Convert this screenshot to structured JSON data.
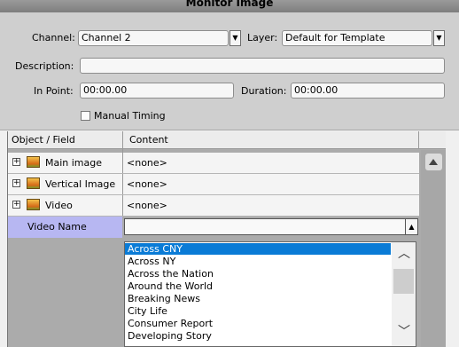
{
  "window": {
    "title": "Monitor Image"
  },
  "form": {
    "channel_label": "Channel:",
    "channel_value": "Channel 2",
    "layer_label": "Layer:",
    "layer_value": "Default for Template",
    "description_label": "Description:",
    "description_value": "",
    "in_point_label": "In Point:",
    "in_point_value": "00:00.00",
    "duration_label": "Duration:",
    "duration_value": "00:00.00",
    "manual_timing_label": "Manual Timing",
    "manual_timing_checked": false
  },
  "grid": {
    "columns": [
      "Object / Field",
      "Content"
    ],
    "rows": [
      {
        "name": "Main image",
        "content": "<none>",
        "icon": "image-icon"
      },
      {
        "name": "Vertical Image",
        "content": "<none>",
        "icon": "image-icon"
      },
      {
        "name": "Video",
        "content": "<none>",
        "icon": "image-icon"
      }
    ],
    "selected_field": {
      "name": "Video Name",
      "value": ""
    }
  },
  "dropdown": {
    "items": [
      "Across CNY",
      "Across NY",
      "Across the Nation",
      "Around the World",
      "Breaking News",
      "City Life",
      "Consumer Report",
      "Developing Story"
    ],
    "selected_index": 0
  },
  "icons": {
    "expand": "plus-box-icon",
    "image": "image-icon",
    "scroll_up": "triangle-up-icon",
    "list_up": "chevron-up-icon",
    "list_down": "chevron-down-icon"
  },
  "colors": {
    "selection": "#0a7bd6",
    "active_field": "#b7b7f2"
  }
}
